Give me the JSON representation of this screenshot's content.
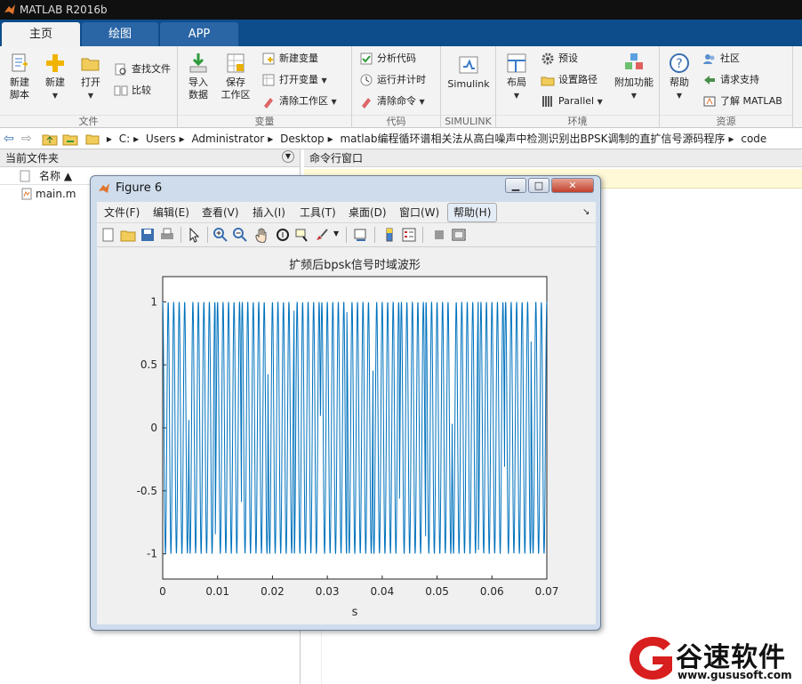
{
  "app": {
    "title": "MATLAB R2016b"
  },
  "tabs": [
    {
      "label": "主页"
    },
    {
      "label": "绘图"
    },
    {
      "label": "APP"
    }
  ],
  "ribbon": {
    "file": {
      "group_label": "文件",
      "new_script": "新建\n脚本",
      "new": "新建",
      "open": "打开",
      "find_files": "查找文件",
      "compare": "比较"
    },
    "variable": {
      "group_label": "变量",
      "import_data": "导入\n数据",
      "save_workspace": "保存\n工作区",
      "new_variable": "新建变量",
      "open_variable": "打开变量",
      "clear_workspace": "清除工作区"
    },
    "code": {
      "group_label": "代码",
      "analyze_code": "分析代码",
      "run_and_time": "运行并计时",
      "clear_commands": "清除命令"
    },
    "simulink": {
      "group_label": "SIMULINK",
      "simulink": "Simulink"
    },
    "environment": {
      "group_label": "环境",
      "layout": "布局",
      "preferences": "预设",
      "set_path": "设置路径",
      "parallel": "Parallel",
      "addons": "附加功能"
    },
    "resources": {
      "group_label": "资源",
      "help": "帮助",
      "community": "社区",
      "request_support": "请求支持",
      "learn_matlab": "了解 MATLAB"
    }
  },
  "address": {
    "crumbs": [
      "C:",
      "Users",
      "Administrator",
      "Desktop",
      "matlab编程循环谱相关法从高白噪声中检测识别出BPSK调制的直扩信号源码程序",
      "code"
    ]
  },
  "current_folder": {
    "title": "当前文件夹",
    "column_name": "名称 ▲",
    "files": [
      {
        "name": "main.m"
      }
    ]
  },
  "command_window": {
    "title": "命令行窗口"
  },
  "figure": {
    "title": "Figure 6",
    "menus": [
      "文件(F)",
      "编辑(E)",
      "查看(V)",
      "插入(I)",
      "工具(T)",
      "桌面(D)",
      "窗口(W)",
      "帮助(H)"
    ]
  },
  "chart_data": {
    "type": "line",
    "title": "扩频后bpsk信号时域波形",
    "xlabel": "s",
    "ylabel": "",
    "xlim": [
      0,
      0.07
    ],
    "ylim": [
      -1.2,
      1.2
    ],
    "xticks": [
      "0",
      "0.01",
      "0.02",
      "0.03",
      "0.04",
      "0.05",
      "0.06",
      "0.07"
    ],
    "yticks": [
      "-1",
      "-0.5",
      "0",
      "0.5",
      "1"
    ],
    "xtick_values": [
      0,
      0.01,
      0.02,
      0.03,
      0.04,
      0.05,
      0.06,
      0.07
    ],
    "ytick_values": [
      -1,
      -0.5,
      0,
      0.5,
      1
    ],
    "series": [
      {
        "color": "#0072bd",
        "cycles": 70,
        "amplitude": 1
      }
    ],
    "grid": false
  },
  "watermark": {
    "name": "谷速软件",
    "url": "www.gususoft.com"
  }
}
